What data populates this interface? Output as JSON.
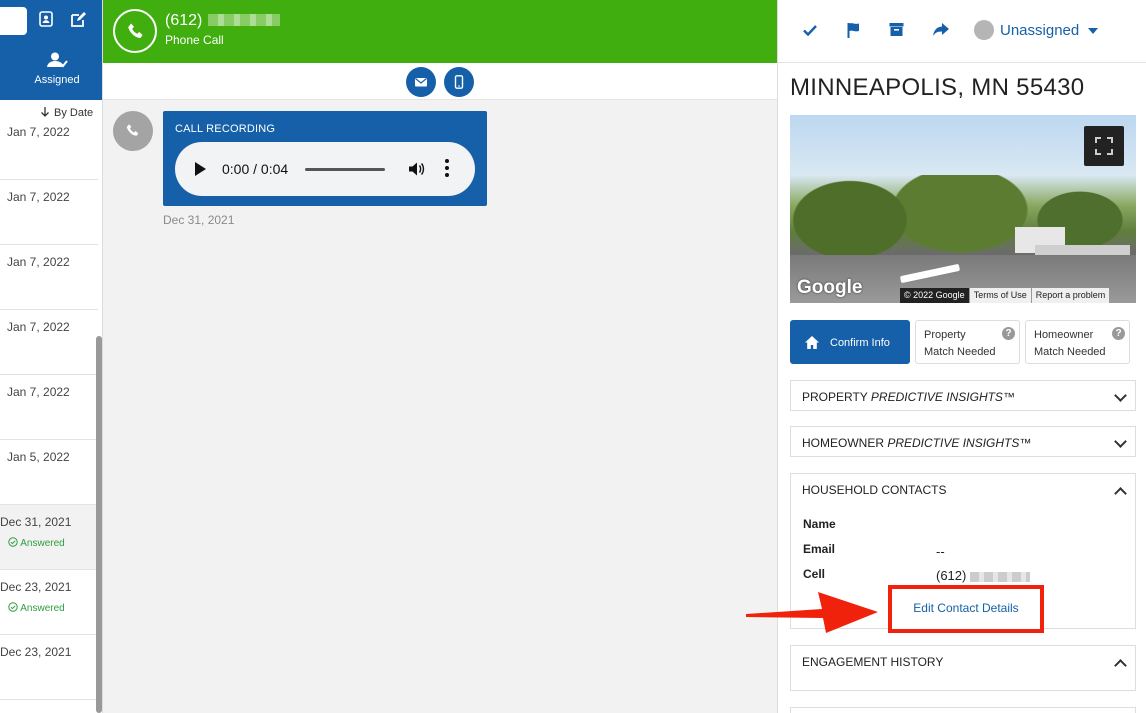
{
  "left": {
    "assigned_label": "Assigned",
    "sort_label": "By Date",
    "items": [
      {
        "date": "Jan 7, 2022",
        "status": ""
      },
      {
        "date": "Jan 7, 2022",
        "status": ""
      },
      {
        "date": "Jan 7, 2022",
        "status": ""
      },
      {
        "date": "Jan 7, 2022",
        "status": ""
      },
      {
        "date": "Jan 7, 2022",
        "status": ""
      },
      {
        "date": "Jan 5, 2022",
        "status": ""
      },
      {
        "date": "Dec 31, 2021",
        "status": "Answered"
      },
      {
        "date": "Dec 23, 2021",
        "status": "Answered"
      },
      {
        "date": "Dec 23, 2021",
        "status": ""
      }
    ]
  },
  "call": {
    "number": "(612)",
    "type": "Phone Call",
    "recording_title": "CALL RECORDING",
    "audio_time": "0:00 / 0:04",
    "message_date": "Dec 31, 2021"
  },
  "right": {
    "assignee": "Unassigned",
    "address": "MINNEAPOLIS, MN 55430",
    "map": {
      "logo": "Google",
      "copyright": "© 2022 Google",
      "terms": "Terms of Use",
      "report": "Report a problem"
    },
    "actions": {
      "confirm": "Confirm Info",
      "property_l1": "Property",
      "property_l2": "Match Needed",
      "homeowner_l1": "Homeowner",
      "homeowner_l2": "Match Needed",
      "help": "?"
    },
    "panels": {
      "property_prefix": "PROPERTY ",
      "property_suffix": "PREDICTIVE INSIGHTS™",
      "homeowner_prefix": "HOMEOWNER ",
      "homeowner_suffix": "PREDICTIVE INSIGHTS™",
      "household": "HOUSEHOLD CONTACTS",
      "engagement": "ENGAGEMENT HISTORY"
    },
    "household": {
      "name_label": "Name",
      "email_label": "Email",
      "email_value": "--",
      "cell_label": "Cell",
      "cell_value": "(612)",
      "edit_link": "Edit Contact Details"
    }
  },
  "colors": {
    "brand_blue": "#1560a8",
    "call_green": "#3fae0e",
    "status_green": "#2e9e3e",
    "callout_red": "#f0220c"
  }
}
